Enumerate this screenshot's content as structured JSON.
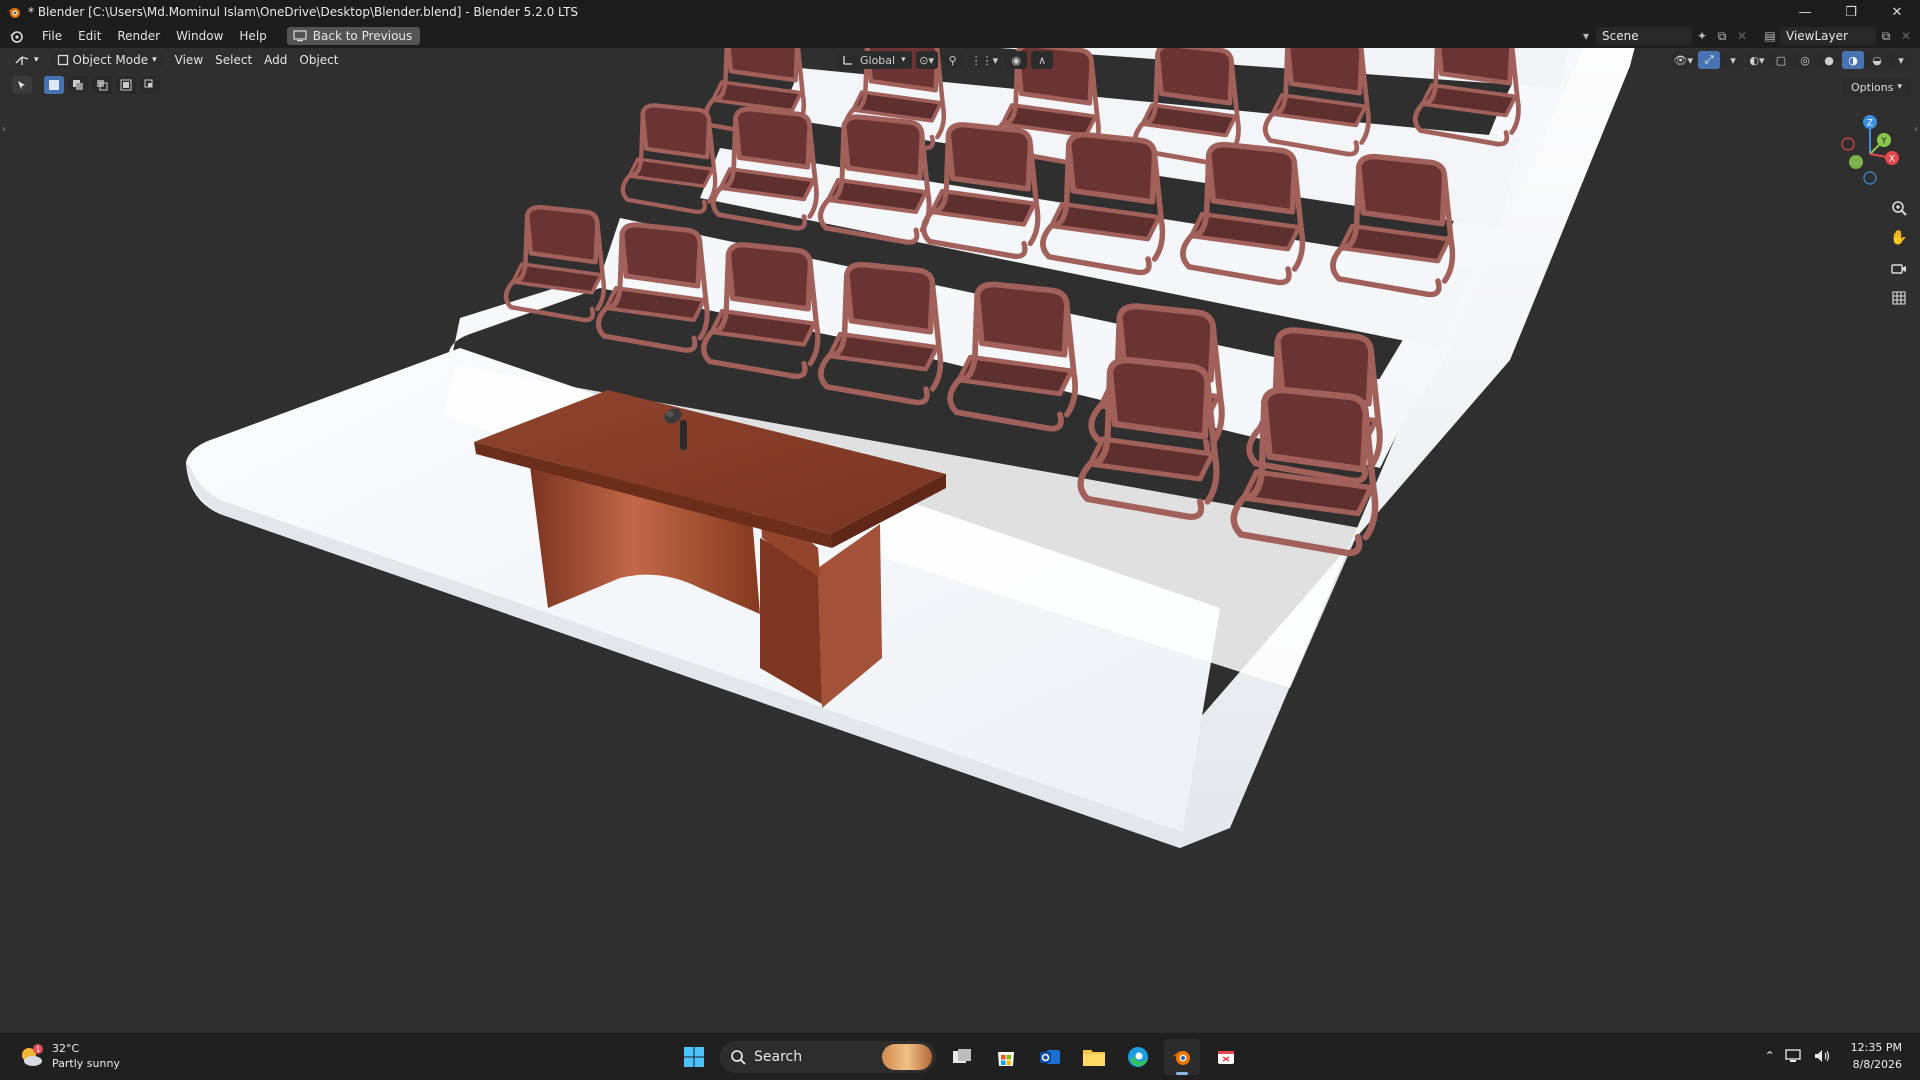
{
  "window": {
    "title": "* Blender [C:\\Users\\Md.Mominul Islam\\OneDrive\\Desktop\\Blender.blend] - Blender 5.2.0 LTS",
    "controls": [
      "—",
      "❐",
      "✕"
    ]
  },
  "menubar": {
    "items": [
      "File",
      "Edit",
      "Render",
      "Window",
      "Help"
    ],
    "back_button": "Back to Previous",
    "scene_label": "Scene",
    "view_layer_label": "ViewLayer"
  },
  "viewport_header": {
    "mode": "Object Mode",
    "menus": [
      "View",
      "Select",
      "Add",
      "Object"
    ],
    "transform_orientation": "Global",
    "options_label": "Options"
  },
  "gizmo": {
    "axes": [
      "Z",
      "Y",
      "X"
    ],
    "colors": {
      "x": "#e5484d",
      "y": "#8ac84b",
      "z": "#3d8fe0"
    }
  },
  "scene": {
    "colors": {
      "background": "#303030",
      "stairs": "#f4f6fa",
      "desk": "#8a3f2a",
      "chair": "#6b3434",
      "chair_frame": "#9c5a50"
    },
    "objects": [
      "stepped-platform",
      "desk",
      "microphone",
      "chairs"
    ]
  },
  "taskbar": {
    "weather_temp": "32°C",
    "weather_desc": "Partly sunny",
    "weather_badge": "1",
    "search_placeholder": "Search",
    "time": "12:35 PM",
    "date": "8/8/2026"
  }
}
